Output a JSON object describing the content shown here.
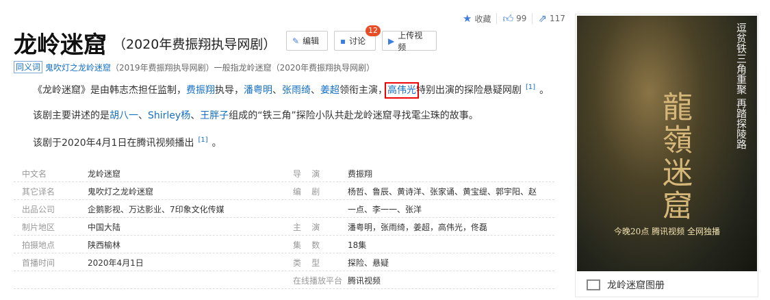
{
  "stats": {
    "favorite_label": "收藏",
    "likes": "99",
    "shares": "117"
  },
  "title": {
    "main": "龙岭迷窟",
    "sub": "（2020年费振翔执导网剧）"
  },
  "buttons": {
    "edit": "编辑",
    "discuss": "讨论",
    "discuss_badge": "12",
    "upload": "上传视频"
  },
  "synonym": {
    "tag": "同义词",
    "link": "鬼吹灯之龙岭迷窟",
    "text": "（2019年费振翔执导网剧）一般指龙岭迷窟（2020年费振翔执导网剧）"
  },
  "para1": {
    "t1": "《龙岭迷窟》是由韩志杰担任监制，",
    "l1": "费振翔",
    "t2": "执导，",
    "l2": "潘粤明",
    "t3": "、",
    "l3": "张雨绮",
    "t4": "、",
    "l4": "姜超",
    "t5": "领衔主演，",
    "l5": "高伟光",
    "t6": "特别出演的探险悬疑网剧",
    "ref": "[1]",
    "t7": "。"
  },
  "para2": {
    "t1": "该剧主要讲述的是",
    "l1": "胡八一",
    "t2": "、",
    "l2": "Shirley杨",
    "t3": "、",
    "l3": "王胖子",
    "t4": "组成的“铁三角”探险小队共赴龙岭迷窟寻找雮尘珠的故事。"
  },
  "para3": {
    "t1": "该剧于2020年4月1日在腾讯视频播出",
    "ref": "[1]",
    "t2": "。"
  },
  "info": [
    {
      "l": "中文名",
      "v": "龙岭迷窟",
      "rl": "导    演",
      "rv": "费振翔"
    },
    {
      "l": "其它译名",
      "v": "鬼吹灯之龙岭迷窟",
      "rl": "编    剧",
      "rv": "杨哲、鲁辰、黄诗洋、张家诵、黄宝缇、郭宇阳、赵"
    },
    {
      "l": "出品公司",
      "v": "企鹅影视、万达影业、7印象文化传媒",
      "rl": "",
      "rv": "一点、李一一、张洋"
    },
    {
      "l": "制片地区",
      "v": "中国大陆",
      "rl": "主    演",
      "rv": "潘粤明，张雨绮，姜超，高伟光，佟磊"
    },
    {
      "l": "拍摄地点",
      "v": "陕西榆林",
      "rl": "集    数",
      "rv": "18集"
    },
    {
      "l": "首播时间",
      "v": "2020年4月1日",
      "rl": "类    型",
      "rv": "探险、悬疑"
    },
    {
      "l": "",
      "v": "",
      "rl": "在线播放平台",
      "rv": "腾讯视频"
    }
  ],
  "poster": {
    "title": "龍嶺迷窟",
    "slogan": "逗贫铁三角重聚 再踏探陵路",
    "bottom": "今晚20点 腾讯视频 全网独播",
    "caption": "龙岭迷窟图册"
  }
}
